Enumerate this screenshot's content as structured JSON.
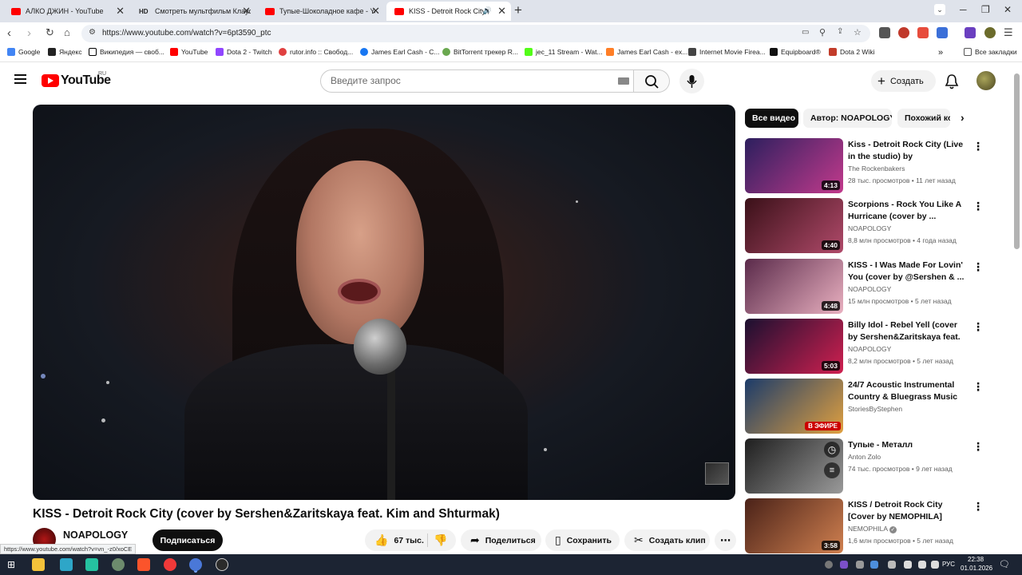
{
  "browser": {
    "tabs": [
      {
        "title": "АЛКО ДЖИН - YouTube",
        "favicon_color": "#ff0000"
      },
      {
        "title": "Смотреть мультфильм Клаус",
        "favicon_text": "HD",
        "favicon_color": "#333333"
      },
      {
        "title": "Тупые-Шоколадное кафе - Yo",
        "favicon_color": "#ff0000"
      },
      {
        "title": "KISS - Detroit Rock City (co",
        "favicon_color": "#ff0000"
      }
    ],
    "url": "https://www.youtube.com/watch?v=6pt3590_ptc",
    "bookmarks": [
      {
        "label": "Google",
        "color": "#4285f4"
      },
      {
        "label": "Яндекс",
        "color": "#222222"
      },
      {
        "label": "Википедия — своб...",
        "color": "#000000"
      },
      {
        "label": "YouTube",
        "color": "#ff0000"
      },
      {
        "label": "Dota 2 - Twitch",
        "color": "#9146ff"
      },
      {
        "label": "rutor.info :: Свобод...",
        "color": "#e04040"
      },
      {
        "label": "James Earl Cash - C...",
        "color": "#1877f2"
      },
      {
        "label": "BitTorrent трекер R...",
        "color": "#6aa84f"
      },
      {
        "label": "jec_11 Stream - Wat...",
        "color": "#53fc18"
      },
      {
        "label": "James Earl Cash - ex...",
        "color": "#ff7f27"
      },
      {
        "label": "Internet Movie Firea...",
        "color": "#444444"
      },
      {
        "label": "Equipboard®",
        "color": "#111111"
      },
      {
        "label": "Dota 2 Wiki",
        "color": "#c23c2a"
      }
    ],
    "all_bookmarks": "Все закладки",
    "status_url": "https://www.youtube.com/watch?v=vn_-z0/xoCE"
  },
  "youtube": {
    "logo_text": "YouTube",
    "region": "RU",
    "search_placeholder": "Введите запрос",
    "create_label": "Создать",
    "video": {
      "title": "KISS - Detroit Rock City (cover by Sershen&Zaritskaya feat. Kim and Shturmak)",
      "channel": "NOAPOLOGY",
      "subscribe_label": "Подписаться",
      "likes": "67 тыс.",
      "share_label": "Поделиться",
      "save_label": "Сохранить",
      "clip_label": "Создать клип"
    },
    "chips": [
      "Все видео",
      "Автор: NOAPOLOGY",
      "Похожий ко"
    ],
    "related": [
      {
        "title": "Kiss - Detroit Rock City (Live in the studio) by Rockenbakers ...",
        "channel": "The Rockenbakers",
        "views": "28 тыс. просмотров",
        "age": "11 лет назад",
        "duration": "4:13",
        "c1": "#2c1f5e",
        "c2": "#c23a8c"
      },
      {
        "title": "Scorpions - Rock You Like A Hurricane (cover by ...",
        "channel": "NOAPOLOGY",
        "views": "8,8 млн просмотров",
        "age": "4 года назад",
        "duration": "4:40",
        "c1": "#3a1018",
        "c2": "#b04a6a"
      },
      {
        "title": "KISS - I Was Made For Lovin' You (cover by @Sershen & ...",
        "channel": "NOAPOLOGY",
        "views": "15 млн просмотров",
        "age": "5 лет назад",
        "duration": "4:48",
        "c1": "#5a2a4a",
        "c2": "#e9b0c0"
      },
      {
        "title": "Billy Idol - Rebel Yell (cover by Sershen&Zaritskaya feat. Kim ...",
        "channel": "NOAPOLOGY",
        "views": "8,2 млн просмотров",
        "age": "5 лет назад",
        "duration": "5:03",
        "c1": "#1a1030",
        "c2": "#d02050"
      },
      {
        "title": "24/7 Acoustic Instrumental Country & Bluegrass Music Ba...",
        "channel": "StoriesByStephen",
        "views": "",
        "age": "",
        "live_label": "В ЭФИРЕ",
        "c1": "#1b3b6a",
        "c2": "#e0a040"
      },
      {
        "title": "Тупые - Металл",
        "channel": "Anton Zolo",
        "views": "74 тыс. просмотров",
        "age": "9 лет назад",
        "duration": "",
        "c1": "#1e1e1e",
        "c2": "#9a9a9a"
      },
      {
        "title": "KISS / Detroit Rock City [Cover by NEMOPHILA]",
        "channel": "NEMOPHILA",
        "views": "1,6 млн просмотров",
        "age": "5 лет назад",
        "duration": "3:58",
        "c1": "#4a2218",
        "c2": "#d08050"
      }
    ]
  },
  "taskbar": {
    "lang": "РУС",
    "time": "22:38",
    "date": "01.01.2026"
  }
}
